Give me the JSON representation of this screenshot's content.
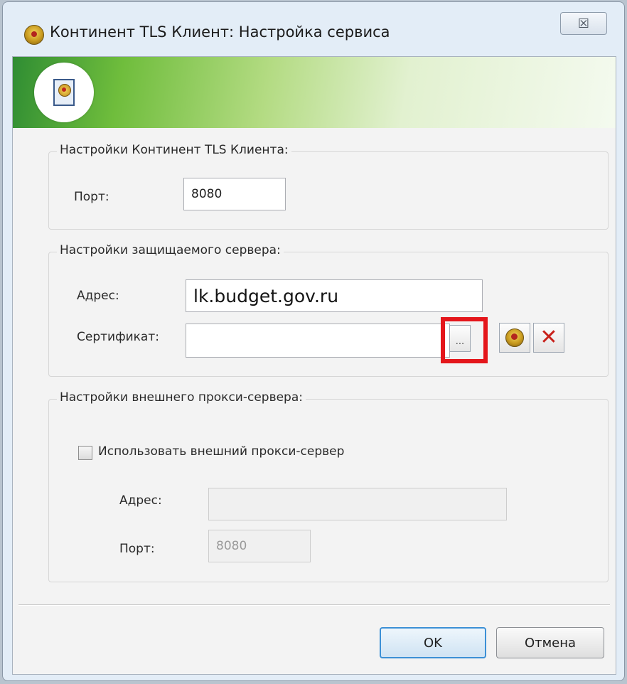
{
  "window": {
    "title": "Континент TLS Клиент: Настройка сервиса",
    "close_glyph": "☒"
  },
  "client_group": {
    "title": "Настройки Континент TLS Клиента:",
    "port_label": "Порт:",
    "port_value": "8080"
  },
  "server_group": {
    "title": "Настройки защищаемого сервера:",
    "address_label": "Адрес:",
    "address_value": "lk.budget.gov.ru",
    "certificate_label": "Сертификат:",
    "certificate_value": "",
    "browse_label": "...",
    "delete_glyph": "✕"
  },
  "proxy_group": {
    "title": "Настройки внешнего прокси-сервера:",
    "use_proxy_label": "Использовать внешний прокси-сервер",
    "use_proxy_checked": false,
    "address_label": "Адрес:",
    "address_value": "",
    "port_label": "Порт:",
    "port_value": "8080"
  },
  "buttons": {
    "ok_label": "OK",
    "cancel_label": "Отмена"
  },
  "colors": {
    "highlight": "#e4161b",
    "banner_green": "#6fbd3c"
  }
}
